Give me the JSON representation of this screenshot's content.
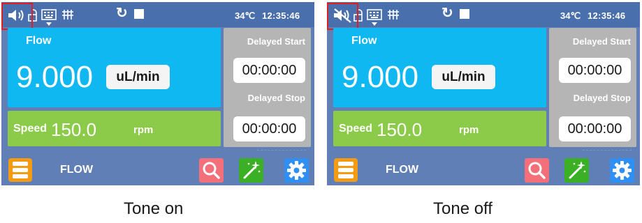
{
  "screens": [
    {
      "status": {
        "speaker_icon": "speaker-on-icon",
        "temperature": "34℃",
        "time": "12:35:46"
      },
      "flow": {
        "label": "Flow",
        "value": "9.000",
        "unit": "uL/min"
      },
      "speed": {
        "label": "Speed",
        "value": "150.0",
        "unit": "rpm"
      },
      "delayed_start": {
        "label": "Delayed Start",
        "time": "00:00:00"
      },
      "delayed_stop": {
        "label": "Delayed Stop",
        "time": "00:00:00"
      },
      "mode": "FLOW"
    },
    {
      "status": {
        "speaker_icon": "speaker-muted-icon",
        "temperature": "34℃",
        "time": "12:35:46"
      },
      "flow": {
        "label": "Flow",
        "value": "9.000",
        "unit": "uL/min"
      },
      "speed": {
        "label": "Speed",
        "value": "150.0",
        "unit": "rpm"
      },
      "delayed_start": {
        "label": "Delayed Start",
        "time": "00:00:00"
      },
      "delayed_stop": {
        "label": "Delayed Stop",
        "time": "00:00:00"
      },
      "mode": "FLOW"
    }
  ],
  "captions": [
    "Tone on",
    "Tone off"
  ],
  "colors": {
    "status_bar": "#4a6fad",
    "background": "#5f7fb6",
    "flow_panel": "#10b8f2",
    "speed_panel": "#8ccb4a",
    "side_panel": "#b5b5b5",
    "highlight": "#e02020",
    "menu_button": "#f39b13",
    "search_button": "#f36f79",
    "wand_button": "#3cb025",
    "gear_button": "#2f8ff3"
  }
}
